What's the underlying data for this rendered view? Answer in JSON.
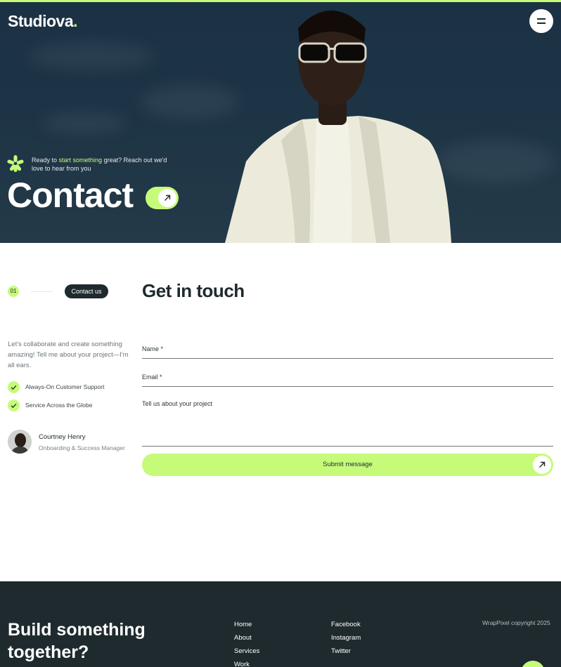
{
  "brand": {
    "name": "Studiova",
    "dot": ".",
    "accent_color": "#c6fb7a",
    "dark_color": "#1f2a2e"
  },
  "header": {
    "menu_icon": "hamburger-icon"
  },
  "hero": {
    "tagline_before": "Ready to ",
    "tagline_highlight": "start something",
    "tagline_after": " great? Reach  out  we'd love to hear from you",
    "title": "Contact",
    "arrow_icon": "arrow-up-right-icon"
  },
  "contact": {
    "step_number": "01",
    "step_label": "Contact us",
    "section_title": "Get in touch",
    "intro": "Let's collaborate and create something amazing! Tell me about your project—I'm all ears.",
    "features": [
      "Always-On Customer Support",
      "Service Across the Globe"
    ],
    "person": {
      "name": "Courtney Henry",
      "role": "Onboarding & Success Manager"
    }
  },
  "form": {
    "name_label": "Name *",
    "email_label": "Email *",
    "project_label": "Tell us about your project",
    "submit_label": "Submit message"
  },
  "footer": {
    "title": "Build something together?",
    "nav_col1": [
      "Home",
      "About",
      "Services",
      "Work"
    ],
    "nav_col2": [
      "Facebook",
      "Instagram",
      "Twitter"
    ],
    "copyright": "WrapPixel copyright 2025"
  }
}
